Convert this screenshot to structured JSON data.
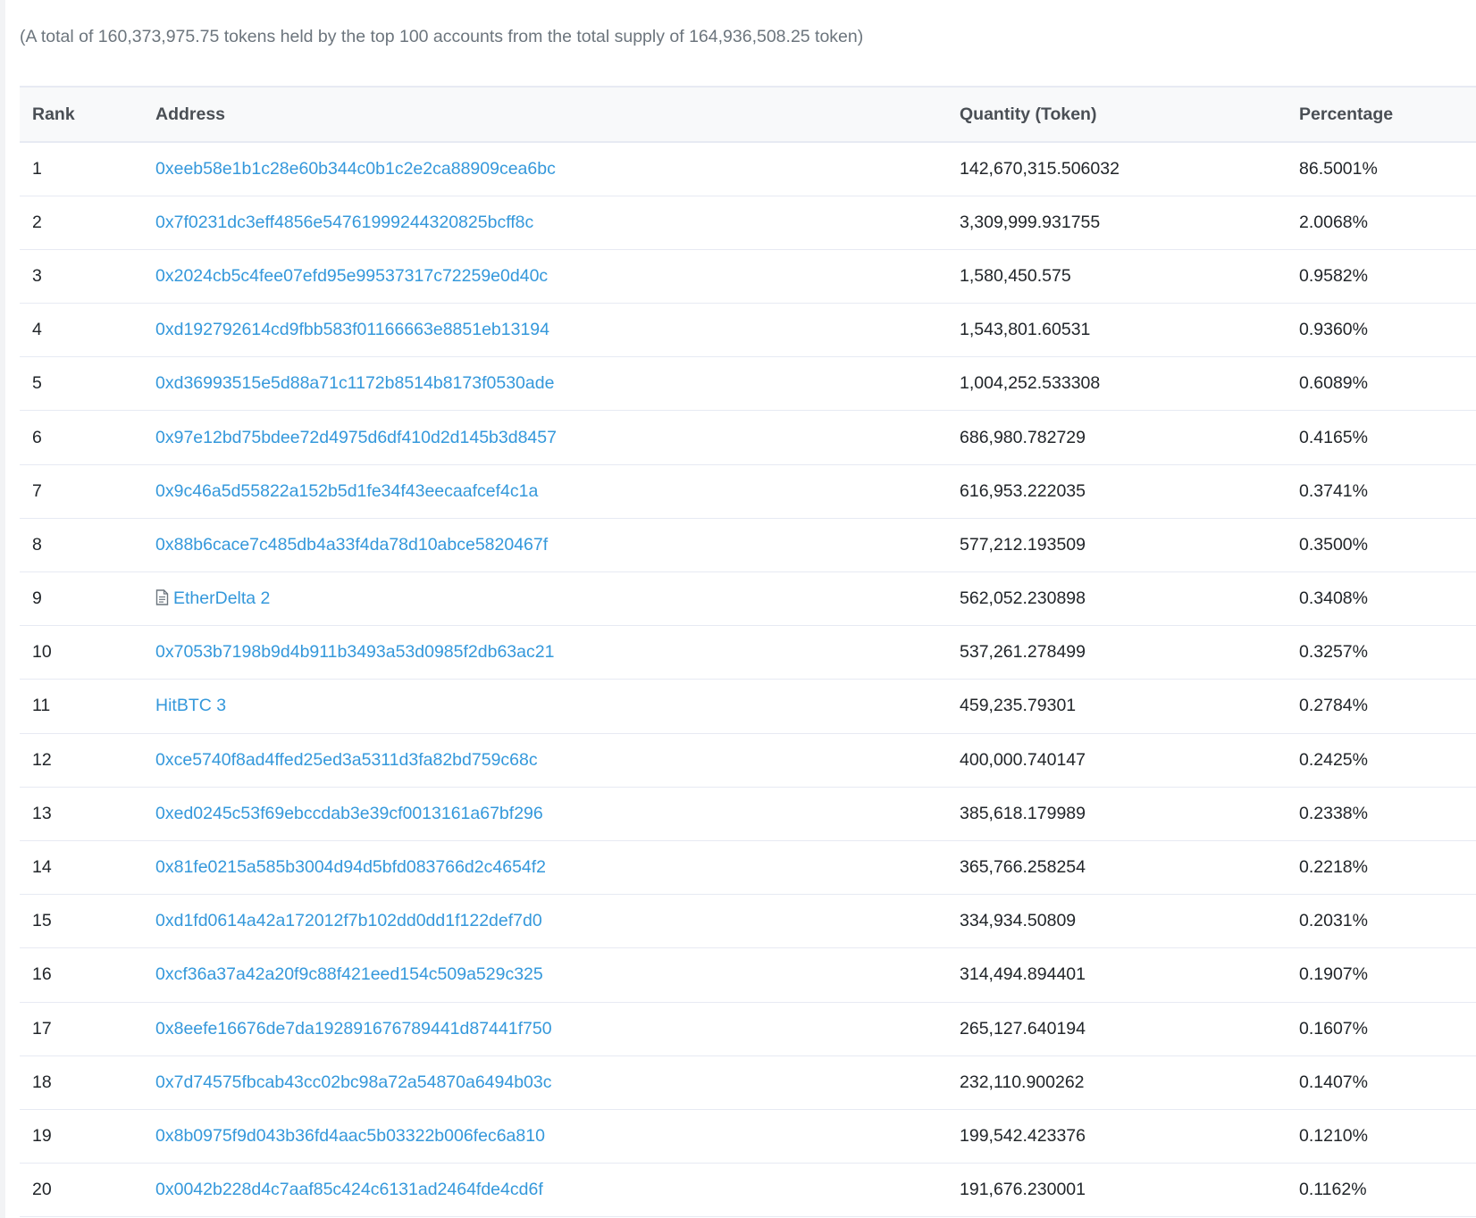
{
  "summary": "(A total of 160,373,975.75 tokens held by the top 100 accounts from the total supply of 164,936,508.25 token)",
  "columns": {
    "rank": "Rank",
    "address": "Address",
    "quantity": "Quantity (Token)",
    "percentage": "Percentage"
  },
  "rows": [
    {
      "rank": "1",
      "address": "0xeeb58e1b1c28e60b344c0b1c2e2ca88909cea6bc",
      "quantity": "142,670,315.506032",
      "percentage": "86.5001%"
    },
    {
      "rank": "2",
      "address": "0x7f0231dc3eff4856e54761999244320825bcff8c",
      "quantity": "3,309,999.931755",
      "percentage": "2.0068%"
    },
    {
      "rank": "3",
      "address": "0x2024cb5c4fee07efd95e99537317c72259e0d40c",
      "quantity": "1,580,450.575",
      "percentage": "0.9582%"
    },
    {
      "rank": "4",
      "address": "0xd192792614cd9fbb583f01166663e8851eb13194",
      "quantity": "1,543,801.60531",
      "percentage": "0.9360%"
    },
    {
      "rank": "5",
      "address": "0xd36993515e5d88a71c1172b8514b8173f0530ade",
      "quantity": "1,004,252.533308",
      "percentage": "0.6089%"
    },
    {
      "rank": "6",
      "address": "0x97e12bd75bdee72d4975d6df410d2d145b3d8457",
      "quantity": "686,980.782729",
      "percentage": "0.4165%"
    },
    {
      "rank": "7",
      "address": "0x9c46a5d55822a152b5d1fe34f43eecaafcef4c1a",
      "quantity": "616,953.222035",
      "percentage": "0.3741%"
    },
    {
      "rank": "8",
      "address": "0x88b6cace7c485db4a33f4da78d10abce5820467f",
      "quantity": "577,212.193509",
      "percentage": "0.3500%"
    },
    {
      "rank": "9",
      "address": "EtherDelta 2",
      "is_contract": true,
      "icon": "contract-document-icon",
      "quantity": "562,052.230898",
      "percentage": "0.3408%"
    },
    {
      "rank": "10",
      "address": "0x7053b7198b9d4b911b3493a53d0985f2db63ac21",
      "quantity": "537,261.278499",
      "percentage": "0.3257%"
    },
    {
      "rank": "11",
      "address": "HitBTC 3",
      "quantity": "459,235.79301",
      "percentage": "0.2784%"
    },
    {
      "rank": "12",
      "address": "0xce5740f8ad4ffed25ed3a5311d3fa82bd759c68c",
      "quantity": "400,000.740147",
      "percentage": "0.2425%"
    },
    {
      "rank": "13",
      "address": "0xed0245c53f69ebccdab3e39cf0013161a67bf296",
      "quantity": "385,618.179989",
      "percentage": "0.2338%"
    },
    {
      "rank": "14",
      "address": "0x81fe0215a585b3004d94d5bfd083766d2c4654f2",
      "quantity": "365,766.258254",
      "percentage": "0.2218%"
    },
    {
      "rank": "15",
      "address": "0xd1fd0614a42a172012f7b102dd0dd1f122def7d0",
      "quantity": "334,934.50809",
      "percentage": "0.2031%"
    },
    {
      "rank": "16",
      "address": "0xcf36a37a42a20f9c88f421eed154c509a529c325",
      "quantity": "314,494.894401",
      "percentage": "0.1907%"
    },
    {
      "rank": "17",
      "address": "0x8eefe16676de7da192891676789441d87441f750",
      "quantity": "265,127.640194",
      "percentage": "0.1607%"
    },
    {
      "rank": "18",
      "address": "0x7d74575fbcab43cc02bc98a72a54870a6494b03c",
      "quantity": "232,110.900262",
      "percentage": "0.1407%"
    },
    {
      "rank": "19",
      "address": "0x8b0975f9d043b36fd4aac5b03322b006fec6a810",
      "quantity": "199,542.423376",
      "percentage": "0.1210%"
    },
    {
      "rank": "20",
      "address": "0x0042b228d4c7aaf85c424c6131ad2464fde4cd6f",
      "quantity": "191,676.230001",
      "percentage": "0.1162%"
    }
  ],
  "colors": {
    "link": "#3498db",
    "header_bg": "#f8f9fa",
    "border": "#e7eaf3",
    "muted_text": "#6c757d"
  }
}
